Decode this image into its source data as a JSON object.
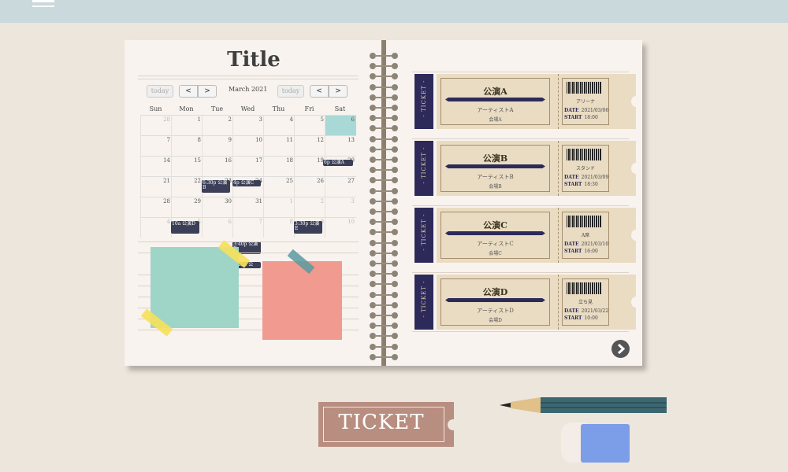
{
  "header": {
    "menu_icon": "hamburger-icon",
    "bg_color": "#c9d9dc"
  },
  "calendar": {
    "title": "Title",
    "today_label": "today",
    "prev_icon": "chevron-left-icon",
    "next_icon": "chevron-right-icon",
    "prev_label": "<",
    "next_label": ">",
    "month_label": "March 2021",
    "weekdays": [
      "Sun",
      "Mon",
      "Tue",
      "Wed",
      "Thu",
      "Fri",
      "Sat"
    ],
    "weeks": [
      [
        "28",
        "1",
        "2",
        "3",
        "4",
        "5",
        "6"
      ],
      [
        "7",
        "8",
        "9",
        "10",
        "11",
        "12",
        "13"
      ],
      [
        "14",
        "15",
        "16",
        "17",
        "18",
        "19",
        "20"
      ],
      [
        "21",
        "22",
        "23",
        "24",
        "25",
        "26",
        "27"
      ],
      [
        "28",
        "29",
        "30",
        "31",
        "1",
        "2",
        "3"
      ],
      [
        "4",
        "5",
        "6",
        "7",
        "8",
        "9",
        "10"
      ]
    ],
    "events": {
      "e1": "6p 公演A",
      "e2": "6:30p 公演B",
      "e3": "4p 公演C",
      "e4": "10a 公演D",
      "e5": "3:30p 公演E",
      "e6": "3:40p 公演F",
      "e7": "5:25p 公"
    }
  },
  "tickets": [
    {
      "stub": "- TICKET -",
      "name": "公演A",
      "artist": "アーティストA",
      "venue": "会場A",
      "seat": "アリーナ",
      "date_label": "DATE",
      "date": "2021/03/06",
      "start_label": "START",
      "start": "18:00"
    },
    {
      "stub": "- TICKET -",
      "name": "公演B",
      "artist": "アーティストB",
      "venue": "会場B",
      "seat": "スタンド",
      "date_label": "DATE",
      "date": "2021/03/09",
      "start_label": "START",
      "start": "18:30"
    },
    {
      "stub": "- TICKET -",
      "name": "公演C",
      "artist": "アーティストC",
      "venue": "会場C",
      "seat": "A席",
      "date_label": "DATE",
      "date": "2021/03/10",
      "start_label": "START",
      "start": "16:00"
    },
    {
      "stub": "- TICKET -",
      "name": "公演D",
      "artist": "アーティストD",
      "venue": "会場D",
      "seat": "立ち見",
      "date_label": "DATE",
      "date": "2021/03/22",
      "start_label": "START",
      "start": "10:00"
    }
  ],
  "next_button_icon": "chevron-right-circle-icon",
  "decor": {
    "ticket_label": "TICKET",
    "pencil_icon": "pencil-icon",
    "eraser_icon": "eraser-icon"
  },
  "colors": {
    "ticket_stub": "#2d2a5a",
    "event": "#3b3f57",
    "sticky_green": "#9ed5c7",
    "sticky_pink": "#f19a8f",
    "tape_yellow": "#f6e05a"
  }
}
